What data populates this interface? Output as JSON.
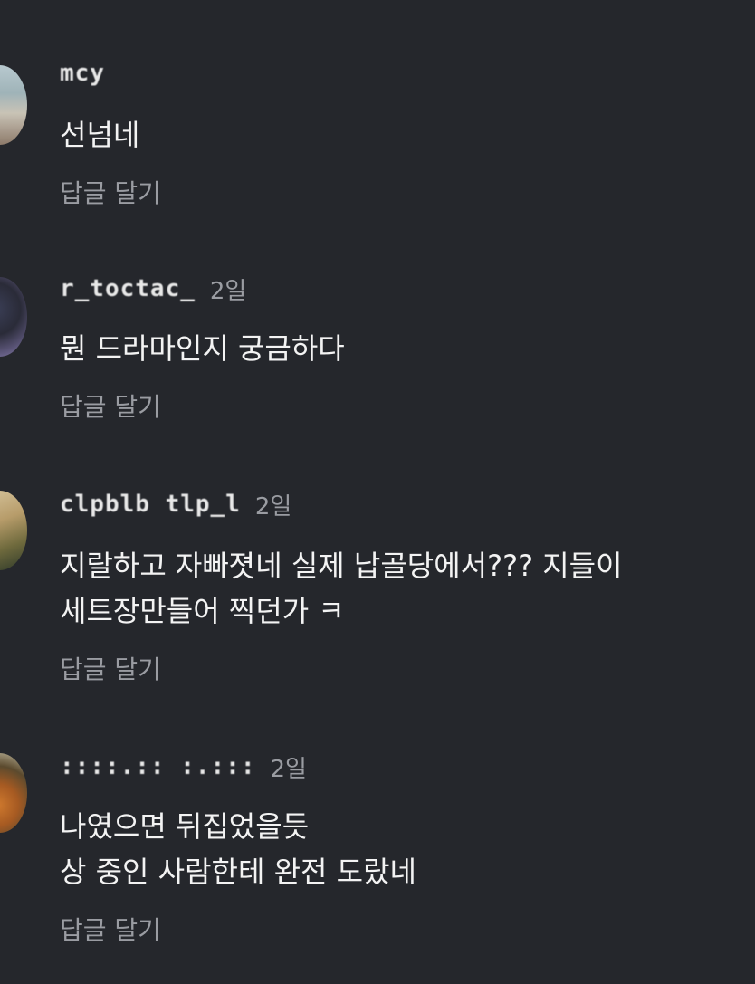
{
  "comments": [
    {
      "username": "mcy     ",
      "time": "",
      "lines": [
        "선넘네"
      ],
      "reply_label": "답글 달기"
    },
    {
      "username": "r_toctac_",
      "time": "2일",
      "lines": [
        "뭔 드라마인지 궁금하다"
      ],
      "reply_label": "답글 달기"
    },
    {
      "username": "clpblb tlp_l",
      "time": "2일",
      "lines": [
        "지랄하고 자빠졋네 실제 납골당에서??? 지들이",
        "세트장만들어 찍던가 ㅋ"
      ],
      "reply_label": "답글 달기"
    },
    {
      "username": "::::.:: :.:::",
      "time": "2일",
      "lines": [
        "나였으면 뒤집었을듯",
        "상 중인 사람한테 완전 도랐네"
      ],
      "reply_label": "답글 달기"
    }
  ]
}
